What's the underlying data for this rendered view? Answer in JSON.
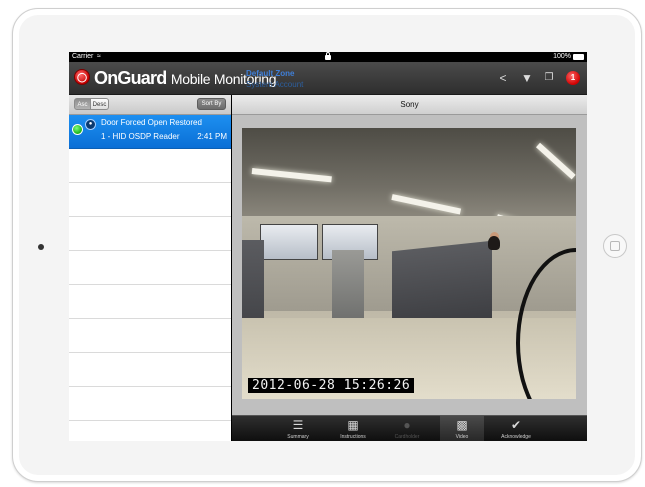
{
  "status_bar": {
    "carrier": "Carrier",
    "battery": "100%"
  },
  "app_bar": {
    "brand_main": "OnGuard",
    "brand_sub": "Mobile Monitoring",
    "zone_title": "Default Zone",
    "zone_subtitle": "System Account",
    "alarm_count": "1"
  },
  "sort": {
    "asc_label": "Asc",
    "desc_label": "Desc",
    "sort_by_label": "Sort By"
  },
  "alarms": [
    {
      "title": "Door Forced Open Restored",
      "source": "1 - HID OSDP Reader",
      "time": "2:41 PM"
    }
  ],
  "detail": {
    "header": "Sony",
    "video_timestamp": "2012-06-28 15:26:26"
  },
  "tabs": [
    {
      "label": "Summary",
      "icon": "list-icon",
      "state": "normal"
    },
    {
      "label": "Instructions",
      "icon": "book-icon",
      "state": "normal"
    },
    {
      "label": "Cardholder",
      "icon": "person-icon",
      "state": "disabled"
    },
    {
      "label": "Video",
      "icon": "film-icon",
      "state": "active"
    },
    {
      "label": "Acknowledge",
      "icon": "checkmark-icon",
      "state": "normal"
    }
  ],
  "colors": {
    "selection_blue": "#0a6fd6",
    "brand_red": "#c80000",
    "zone_blue": "#3f7fd8",
    "status_green": "#19b019"
  }
}
